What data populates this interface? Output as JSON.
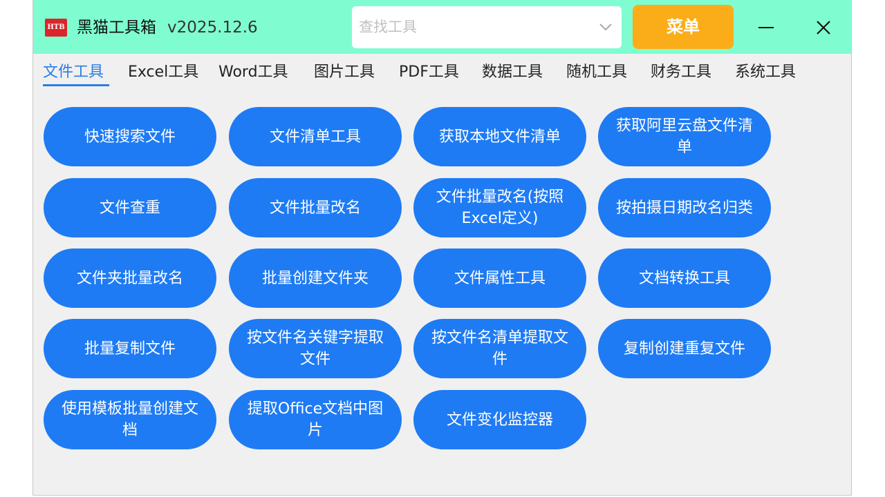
{
  "titlebar": {
    "logo_text": "HTB",
    "app_name": "黑猫工具箱",
    "version": "v2025.12.6",
    "search_placeholder": "查找工具",
    "search_value": "",
    "menu_label": "菜单",
    "minimize_icon": "minimize-icon",
    "close_icon": "close-icon",
    "background_color": "#7ffdd0",
    "menu_color": "#fbad19"
  },
  "tabs": [
    {
      "label": "文件工具",
      "active": true
    },
    {
      "label": "Excel工具",
      "active": false
    },
    {
      "label": "Word工具",
      "active": false
    },
    {
      "label": "图片工具",
      "active": false
    },
    {
      "label": "PDF工具",
      "active": false
    },
    {
      "label": "数据工具",
      "active": false
    },
    {
      "label": "随机工具",
      "active": false
    },
    {
      "label": "财务工具",
      "active": false
    },
    {
      "label": "系统工具",
      "active": false
    }
  ],
  "tools": [
    {
      "label": "快速搜索文件"
    },
    {
      "label": "文件清单工具"
    },
    {
      "label": "获取本地文件清单"
    },
    {
      "label": "获取阿里云盘文件清单"
    },
    {
      "label": "文件查重"
    },
    {
      "label": "文件批量改名"
    },
    {
      "label": "文件批量改名(按照Excel定义)"
    },
    {
      "label": "按拍摄日期改名归类"
    },
    {
      "label": "文件夹批量改名"
    },
    {
      "label": "批量创建文件夹"
    },
    {
      "label": "文件属性工具"
    },
    {
      "label": "文档转换工具"
    },
    {
      "label": "批量复制文件"
    },
    {
      "label": "按文件名关键字提取文件"
    },
    {
      "label": "按文件名清单提取文件"
    },
    {
      "label": "复制创建重复文件"
    },
    {
      "label": "使用模板批量创建文档"
    },
    {
      "label": "提取Office文档中图片"
    },
    {
      "label": "文件变化监控器"
    }
  ],
  "colors": {
    "accent": "#2a7de1",
    "tool_button": "#1e7bf4",
    "window_background": "#f0f0f0"
  }
}
